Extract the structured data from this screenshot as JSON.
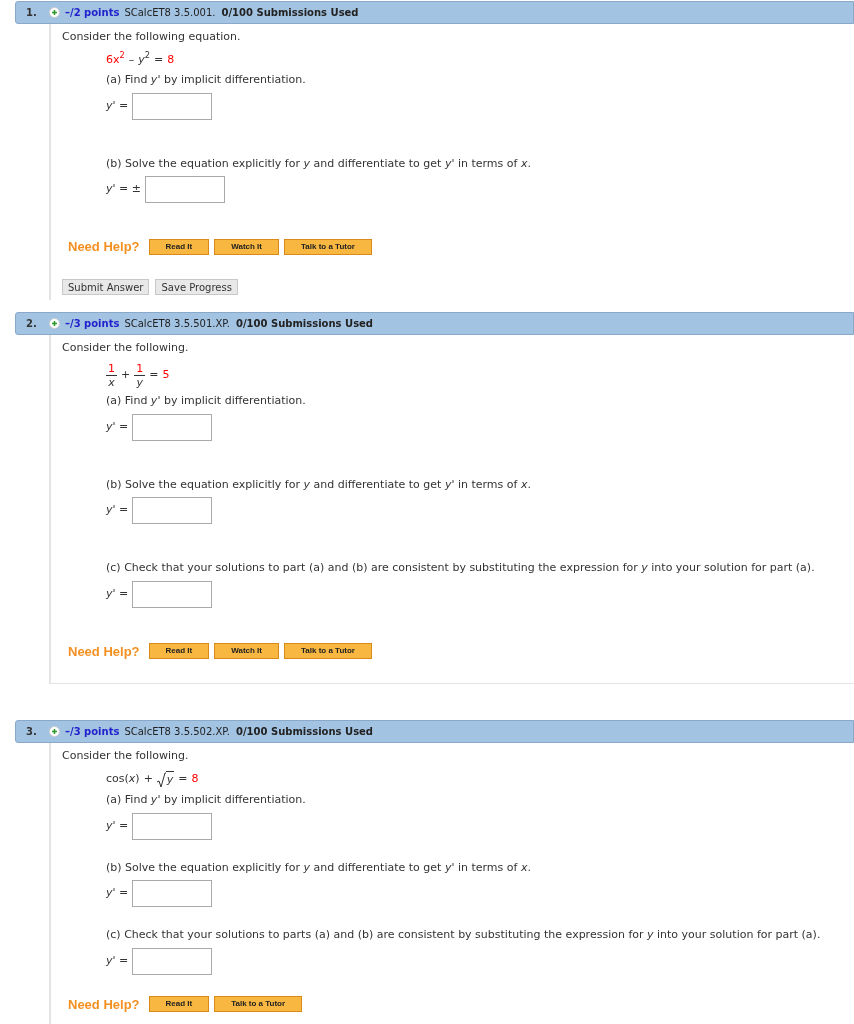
{
  "questions": [
    {
      "number": "1.",
      "points": "–/2 points",
      "source": "SCalcET8 3.5.001.",
      "submissions": "0/100 Submissions Used",
      "intro": "Consider the following equation.",
      "equation": [
        {
          "kind": "given",
          "text": "6x$^{2}$"
        },
        {
          "kind": "op",
          "text": "–"
        },
        {
          "kind": "expr",
          "text": "*y*$^{2}$"
        },
        {
          "kind": "op",
          "text": "="
        },
        {
          "kind": "given",
          "text": "8"
        }
      ],
      "parts": [
        {
          "text": "(a) Find  *y*'  by implicit differentiation.",
          "answer_label": "*y*' ="
        },
        {
          "text": "(b) Solve the equation explicitly for *y* and differentiate to get  *y*'  in terms of *x*.",
          "answer_label": "*y*' = ±"
        }
      ],
      "help_label": "Need Help?",
      "help_buttons": [
        "Read It",
        "Watch It",
        "Talk to a Tutor"
      ],
      "actions": [
        "Submit Answer",
        "Save Progress"
      ]
    },
    {
      "number": "2.",
      "points": "–/3 points",
      "source": "SCalcET8 3.5.501.XP.",
      "submissions": "0/100 Submissions Used",
      "intro": "Consider the following.",
      "equation": [
        {
          "kind": "frac",
          "num": "1",
          "den": "*x*"
        },
        {
          "kind": "op",
          "text": "+"
        },
        {
          "kind": "frac",
          "num": "1",
          "den": "*y*"
        },
        {
          "kind": "op",
          "text": "="
        },
        {
          "kind": "given",
          "text": "5"
        }
      ],
      "parts": [
        {
          "text": "(a) Find *y*' by implicit differentiation.",
          "answer_label": "*y*' ="
        },
        {
          "text": "(b) Solve the equation explicitly for *y* and differentiate to get *y*' in terms of *x*.",
          "answer_label": "*y*' ="
        },
        {
          "text": "(c) Check that your solutions to part (a) and (b) are consistent by substituting the expression for *y* into your solution for part (a).",
          "answer_label": "*y*' ="
        }
      ],
      "help_label": "Need Help?",
      "help_buttons": [
        "Read It",
        "Watch It",
        "Talk to a Tutor"
      ]
    },
    {
      "number": "3.",
      "points": "–/3 points",
      "source": "SCalcET8 3.5.502.XP.",
      "submissions": "0/100 Submissions Used",
      "intro": "Consider the following.",
      "equation": [
        {
          "kind": "expr",
          "text": "cos(*x*)"
        },
        {
          "kind": "op",
          "text": "+"
        },
        {
          "kind": "sqrt",
          "text": "*y*"
        },
        {
          "kind": "op",
          "text": "="
        },
        {
          "kind": "given",
          "text": "8"
        }
      ],
      "parts": [
        {
          "text": "(a) Find *y*' by implicit differentiation.",
          "answer_label": "*y*' ="
        },
        {
          "text": "(b) Solve the equation explicitly for *y* and differentiate to get *y*' in terms of *x*.",
          "answer_label": "*y*' ="
        },
        {
          "text": "(c) Check that your solutions to parts (a) and (b) are consistent by substituting the expression for *y* into your solution for part (a).",
          "answer_label": "*y*' ="
        }
      ],
      "help_label": "Need Help?",
      "help_buttons": [
        "Read It",
        "Talk to a Tutor"
      ]
    }
  ]
}
